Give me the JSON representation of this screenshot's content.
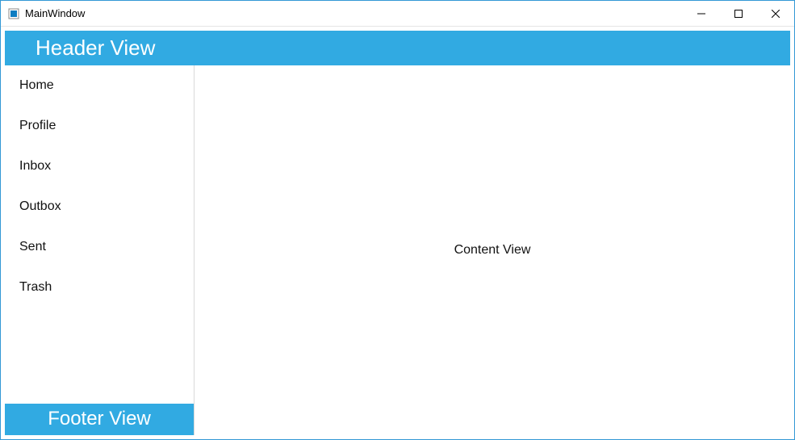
{
  "window": {
    "title": "MainWindow"
  },
  "header": {
    "title": "Header View"
  },
  "sidebar": {
    "items": [
      {
        "label": "Home"
      },
      {
        "label": "Profile"
      },
      {
        "label": "Inbox"
      },
      {
        "label": "Outbox"
      },
      {
        "label": "Sent"
      },
      {
        "label": "Trash"
      }
    ]
  },
  "footer": {
    "title": "Footer View"
  },
  "content": {
    "text": "Content View"
  }
}
